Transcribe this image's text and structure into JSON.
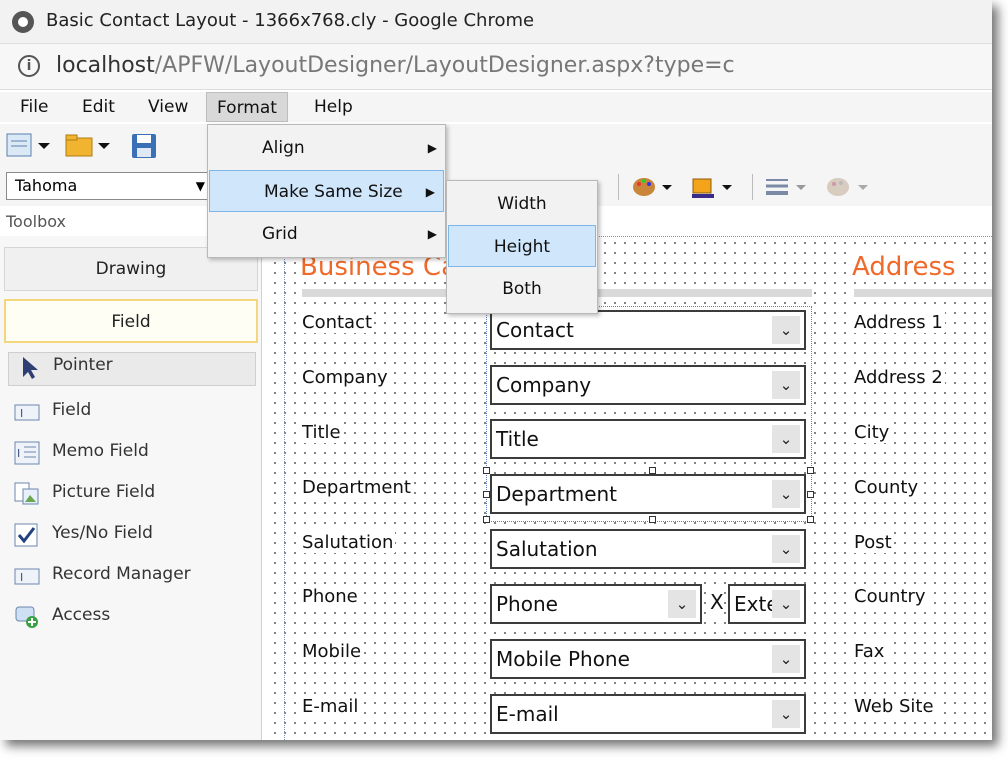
{
  "browser": {
    "title": "Basic Contact Layout - 1366x768.cly - Google Chrome",
    "url_host": "localhost",
    "url_path": "/APFW/LayoutDesigner/LayoutDesigner.aspx?type=c"
  },
  "menu": {
    "file": "File",
    "edit": "Edit",
    "view": "View",
    "format": "Format",
    "help": "Help"
  },
  "format_menu": {
    "align": "Align",
    "make_same_size": "Make Same Size",
    "grid": "Grid"
  },
  "same_size_submenu": {
    "width": "Width",
    "height": "Height",
    "both": "Both"
  },
  "toolbar": {
    "font": "Tahoma"
  },
  "toolbox": {
    "label": "Toolbox",
    "tabs": {
      "drawing": "Drawing",
      "field": "Field"
    },
    "tools": {
      "pointer": "Pointer",
      "field": "Field",
      "memo": "Memo Field",
      "picture": "Picture Field",
      "yesno": "Yes/No Field",
      "record": "Record Manager",
      "access": "Access"
    }
  },
  "canvas": {
    "heading_business": "Business Ca",
    "heading_address": "Address",
    "left_labels": {
      "contact": "Contact",
      "company": "Company",
      "title": "Title",
      "department": "Department",
      "salutation": "Salutation",
      "phone": "Phone",
      "mobile": "Mobile",
      "email": "E-mail"
    },
    "fields": {
      "contact": "Contact",
      "company": "Company",
      "title": "Title",
      "department": "Department",
      "salutation": "Salutation",
      "phone": "Phone",
      "extension": "Exte",
      "mobile": "Mobile Phone",
      "email": "E-mail"
    },
    "x_label": "X",
    "right_labels": {
      "address1": "Address 1",
      "address2": "Address 2",
      "city": "City",
      "county": "County",
      "post": "Post",
      "country": "Country",
      "fax": "Fax",
      "website": "Web Site"
    }
  }
}
